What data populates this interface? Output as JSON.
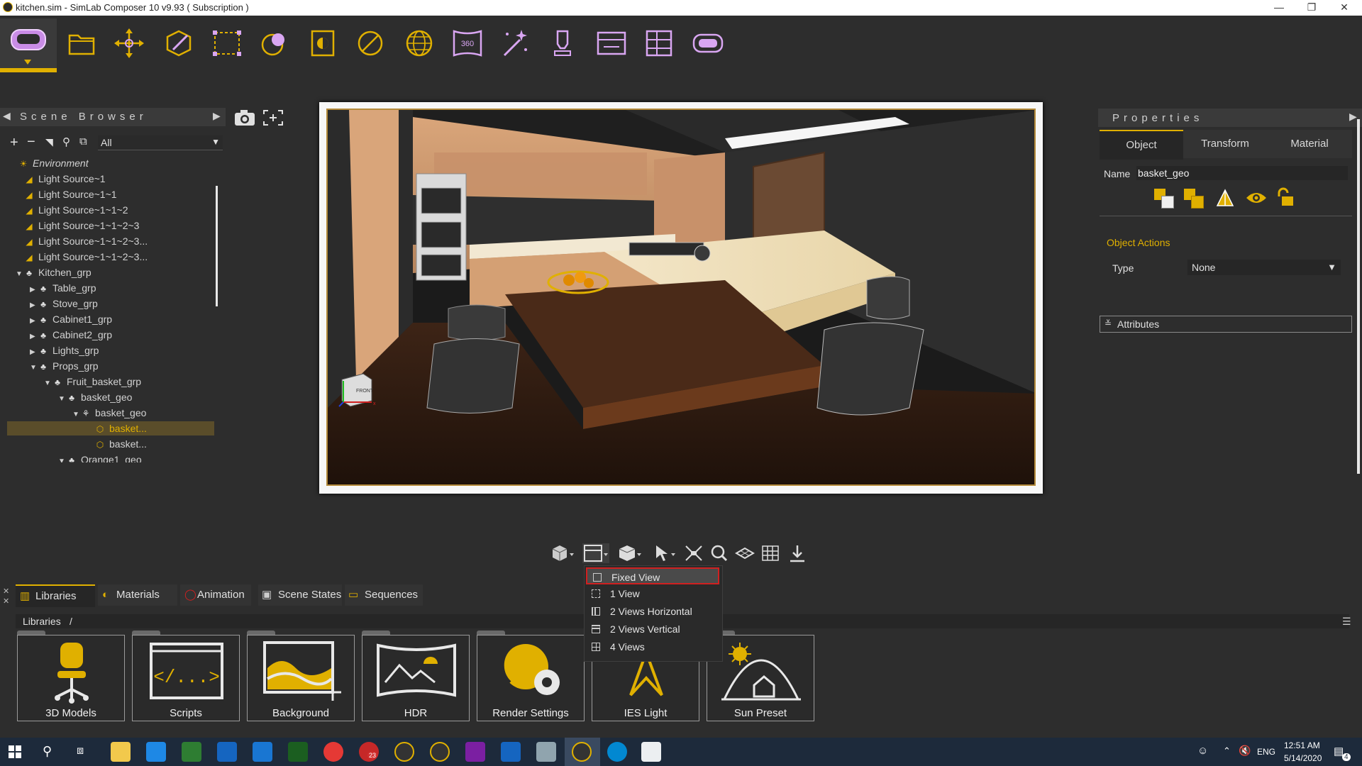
{
  "window": {
    "title": "kitchen.sim - SimLab Composer 10 v9.93 ( Subscription )",
    "minimize": "—",
    "maximize": "❐",
    "close": "✕"
  },
  "toolbar": {
    "icons": [
      "vr-headset-icon",
      "open-folder-icon",
      "move-gizmo-icon",
      "edit-pencil-icon",
      "select-box-icon",
      "materials-icon",
      "render-icon",
      "no-symbol-icon",
      "globe-icon",
      "panorama-360-icon",
      "magic-wand-icon",
      "light-bulb-icon",
      "sequence-icon",
      "layout-grid-icon",
      "vr-goggles-icon"
    ],
    "badge_360": "360"
  },
  "scene_browser": {
    "title": "Scene Browser",
    "filter_value": "All",
    "tree": [
      {
        "label": "Environment",
        "level": 0,
        "icon": "sun-icon",
        "toggle": "",
        "italic": true
      },
      {
        "label": "Light Source~1",
        "level": 1,
        "icon": "light-icon",
        "toggle": ""
      },
      {
        "label": "Light Source~1~1",
        "level": 1,
        "icon": "light-icon",
        "toggle": ""
      },
      {
        "label": "Light Source~1~1~2",
        "level": 1,
        "icon": "light-icon",
        "toggle": ""
      },
      {
        "label": "Light Source~1~1~2~3",
        "level": 1,
        "icon": "light-icon",
        "toggle": ""
      },
      {
        "label": "Light Source~1~1~2~3...",
        "level": 1,
        "icon": "light-icon",
        "toggle": ""
      },
      {
        "label": "Light Source~1~1~2~3...",
        "level": 1,
        "icon": "light-icon",
        "toggle": ""
      },
      {
        "label": "Kitchen_grp",
        "level": 1,
        "icon": "group-icon",
        "toggle": "▼"
      },
      {
        "label": "Table_grp",
        "level": 2,
        "icon": "group-icon",
        "toggle": "▶"
      },
      {
        "label": "Stove_grp",
        "level": 2,
        "icon": "group-icon",
        "toggle": "▶"
      },
      {
        "label": "Cabinet1_grp",
        "level": 2,
        "icon": "group-icon",
        "toggle": "▶"
      },
      {
        "label": "Cabinet2_grp",
        "level": 2,
        "icon": "group-icon",
        "toggle": "▶"
      },
      {
        "label": "Lights_grp",
        "level": 2,
        "icon": "group-icon",
        "toggle": "▶"
      },
      {
        "label": "Props_grp",
        "level": 2,
        "icon": "group-icon",
        "toggle": "▼"
      },
      {
        "label": "Fruit_basket_grp",
        "level": 3,
        "icon": "group-icon",
        "toggle": "▼"
      },
      {
        "label": "basket_geo",
        "level": 4,
        "icon": "group-icon",
        "toggle": "▼"
      },
      {
        "label": "basket_geo",
        "level": 5,
        "icon": "mesh-group-icon",
        "toggle": "▼"
      },
      {
        "label": "basket...",
        "level": 6,
        "icon": "cube-icon",
        "toggle": "",
        "selected": true
      },
      {
        "label": "basket...",
        "level": 6,
        "icon": "cube-icon",
        "toggle": ""
      },
      {
        "label": "Orange1_geo",
        "level": 4,
        "icon": "group-icon",
        "toggle": "▼"
      }
    ]
  },
  "viewport": {
    "nav_cube_label": "FRONT",
    "gizmo_label": "x"
  },
  "properties": {
    "title": "Properties",
    "tabs": [
      "Object",
      "Transform",
      "Material"
    ],
    "active_tab": "Object",
    "name_label": "Name",
    "name_value": "basket_geo",
    "object_actions_label": "Object Actions",
    "type_label": "Type",
    "type_value": "None",
    "attributes_label": "Attributes"
  },
  "view_toolbar": {
    "icons": [
      "view-cube-icon",
      "view-layout-icon",
      "shading-cube-icon",
      "select-arrow-icon",
      "fit-view-icon",
      "zoom-icon",
      "ground-plane-icon",
      "grid-icon",
      "download-icon"
    ]
  },
  "view_dropdown": {
    "items": [
      "Fixed View",
      "1 View",
      "2 Views Horizontal",
      "2 Views Vertical",
      "4 Views"
    ],
    "selected": "Fixed View"
  },
  "bottom_tabs": {
    "items": [
      "Libraries",
      "Materials",
      "Animation",
      "Scene States",
      "Sequences"
    ],
    "active": "Libraries"
  },
  "libraries": {
    "breadcrumb_root": "Libraries",
    "breadcrumb_sep": "/",
    "tiles": [
      "3D Models",
      "Scripts",
      "Background",
      "HDR",
      "Render Settings",
      "IES Light",
      "Sun Preset"
    ]
  },
  "taskbar": {
    "time": "12:51 AM",
    "date": "5/14/2020",
    "language": "ENG",
    "notification_count": "4",
    "calendar_badge": "23"
  },
  "colors": {
    "accent": "#e0b000",
    "toolbar_icon": "#d9a6f2",
    "selection_red": "#d02020"
  }
}
